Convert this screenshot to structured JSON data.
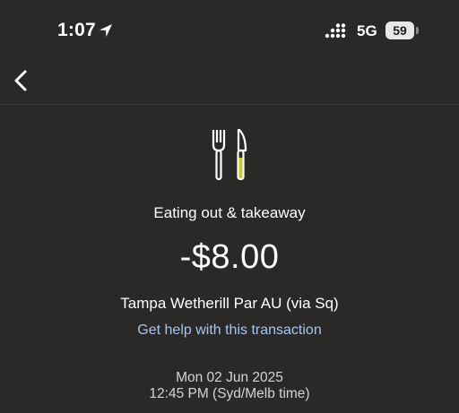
{
  "status_bar": {
    "time": "1:07",
    "location_icon": "location-arrow-icon",
    "signal_icon": "cellular-signal-icon",
    "network": "5G",
    "battery": "59"
  },
  "nav": {
    "back_icon": "chevron-left-icon"
  },
  "transaction": {
    "category_icon": "fork-knife-icon",
    "category": "Eating out & takeaway",
    "amount": "-$8.00",
    "merchant": "Tampa Wetherill Par AU (via Sq)",
    "help_link": "Get help with this transaction",
    "date": "Mon 02 Jun 2025",
    "time": "12:45 PM (Syd/Melb time)"
  },
  "colors": {
    "background": "#2b2928",
    "link": "#a9c4ef",
    "icon_accent": "#c8cc1e"
  }
}
